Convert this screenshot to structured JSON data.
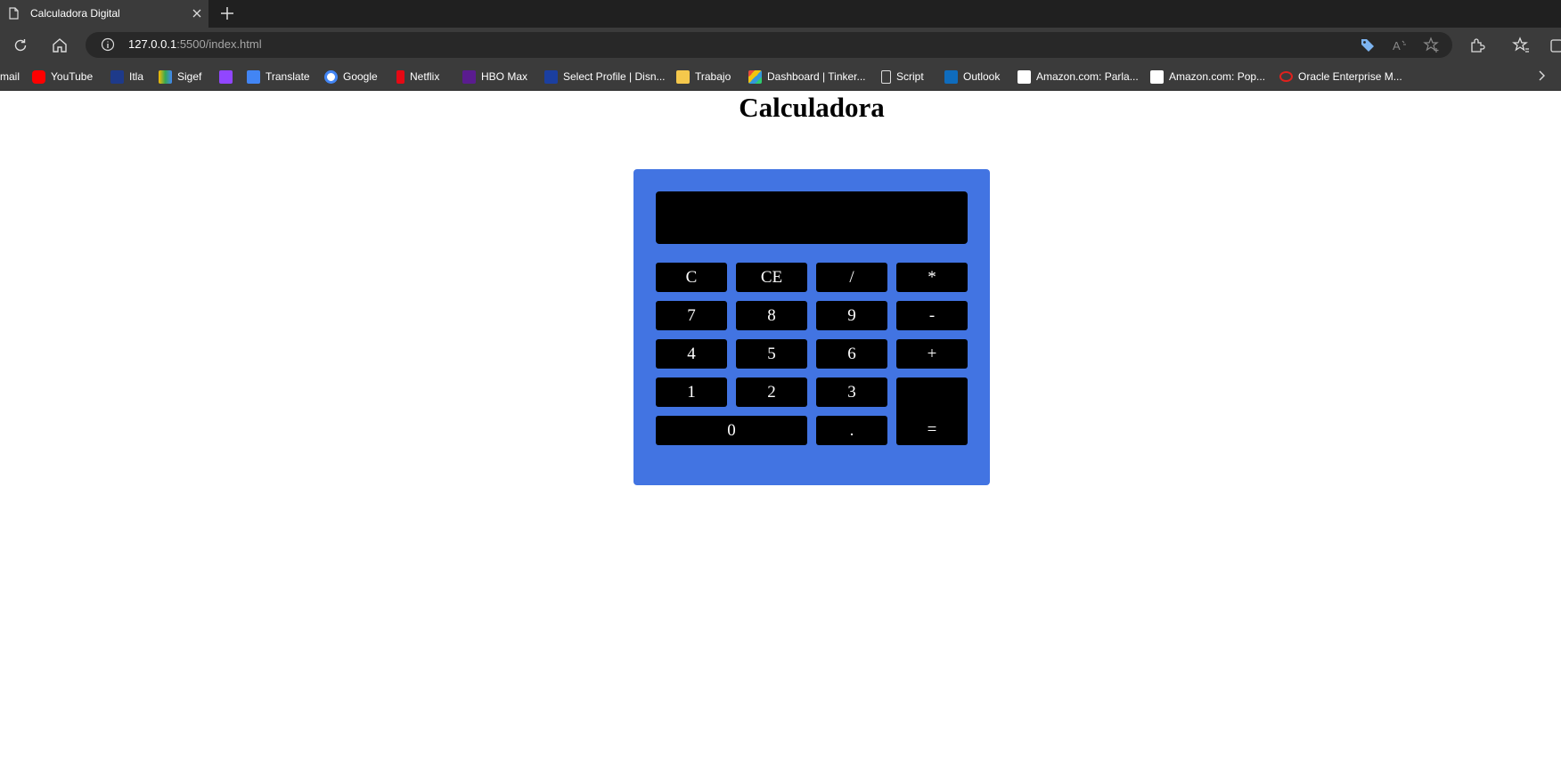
{
  "browser": {
    "tab_title": "Calculadora Digital",
    "url_host": "127.0.0.1",
    "url_rest": ":5500/index.html",
    "bookmarks": [
      {
        "label": "mail",
        "icon": "gmail-icon",
        "color": "#ea4335"
      },
      {
        "label": "YouTube",
        "icon": "youtube-icon",
        "color": "#ff0000"
      },
      {
        "label": "Itla",
        "icon": "itla-icon",
        "color": "#1e3a8a"
      },
      {
        "label": "Sigef",
        "icon": "sigef-icon",
        "color": "#34a853"
      },
      {
        "label": "",
        "icon": "twitch-icon",
        "color": "#9146ff"
      },
      {
        "label": "Translate",
        "icon": "translate-icon",
        "color": "#4285f4"
      },
      {
        "label": "Google",
        "icon": "google-icon",
        "color": "#4285f4"
      },
      {
        "label": "Netflix",
        "icon": "netflix-icon",
        "color": "#e50914"
      },
      {
        "label": "HBO Max",
        "icon": "hbomax-icon",
        "color": "#5a1c8f"
      },
      {
        "label": "Select Profile | Disn...",
        "icon": "disney-icon",
        "color": "#1b3fa0"
      },
      {
        "label": "Trabajo",
        "icon": "folder-icon",
        "color": "#f5c84c"
      },
      {
        "label": "Dashboard | Tinker...",
        "icon": "tinkercad-icon",
        "color": "#e74c3c"
      },
      {
        "label": "Script",
        "icon": "page-icon",
        "color": "#dddddd"
      },
      {
        "label": "Outlook",
        "icon": "outlook-icon",
        "color": "#0f6cbd"
      },
      {
        "label": "Amazon.com: Parla...",
        "icon": "amazon-icon",
        "color": "#ffffff"
      },
      {
        "label": "Amazon.com: Pop...",
        "icon": "amazon-icon",
        "color": "#ffffff"
      },
      {
        "label": "Oracle Enterprise M...",
        "icon": "oracle-icon",
        "color": "#e0211d"
      }
    ]
  },
  "page": {
    "title": "Calculadora",
    "display_value": "",
    "colors": {
      "panel": "#4274e2",
      "key": "#000000",
      "key_text": "#ffffff"
    },
    "keys": {
      "clear": "C",
      "clear_entry": "CE",
      "divide": "/",
      "multiply": "*",
      "seven": "7",
      "eight": "8",
      "nine": "9",
      "minus": "-",
      "four": "4",
      "five": "5",
      "six": "6",
      "plus": "+",
      "one": "1",
      "two": "2",
      "three": "3",
      "equals": "=",
      "zero": "0",
      "decimal": "."
    }
  }
}
